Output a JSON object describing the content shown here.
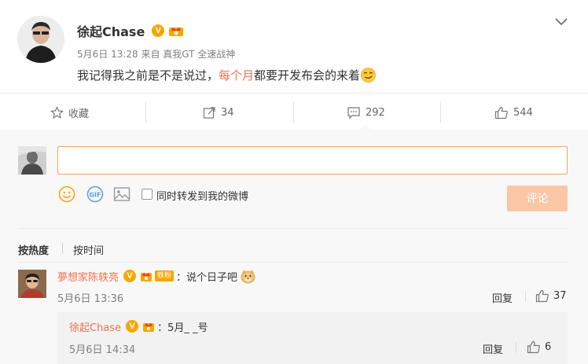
{
  "post": {
    "author": "徐起Chase",
    "verified_badge": "V",
    "meta": "5月6日 13:28 来自 真我GT 全速战神",
    "text_before": "我记得我之前是不是说过，",
    "text_highlight": "每个月",
    "text_after": "都要开发布会的来着",
    "emoji": "smirk-emoji"
  },
  "actions": {
    "favorite_label": "收藏",
    "repost_count": "34",
    "comment_count": "292",
    "like_count": "544"
  },
  "composer": {
    "placeholder": "",
    "forward_label": "同时转发到我的微博",
    "submit_label": "评论"
  },
  "sort": {
    "hot_label": "按热度",
    "time_label": "按时间"
  },
  "comments": [
    {
      "name": "夢想家陈轶亮",
      "badge_text": "铁粉",
      "text": "：说个日子吧",
      "emoji": "doge-emoji",
      "time": "5月6日 13:36",
      "reply_label": "回复",
      "likes": "37"
    }
  ],
  "reply": {
    "name": "徐起Chase",
    "text": "：5月_ _号",
    "time": "5月6日 14:34",
    "reply_label": "回复",
    "likes": "6"
  },
  "colors": {
    "accent": "#eb7350",
    "badge": "#f7a600",
    "button_disabled": "#f9c7a6",
    "input_border": "#f2a45b"
  }
}
